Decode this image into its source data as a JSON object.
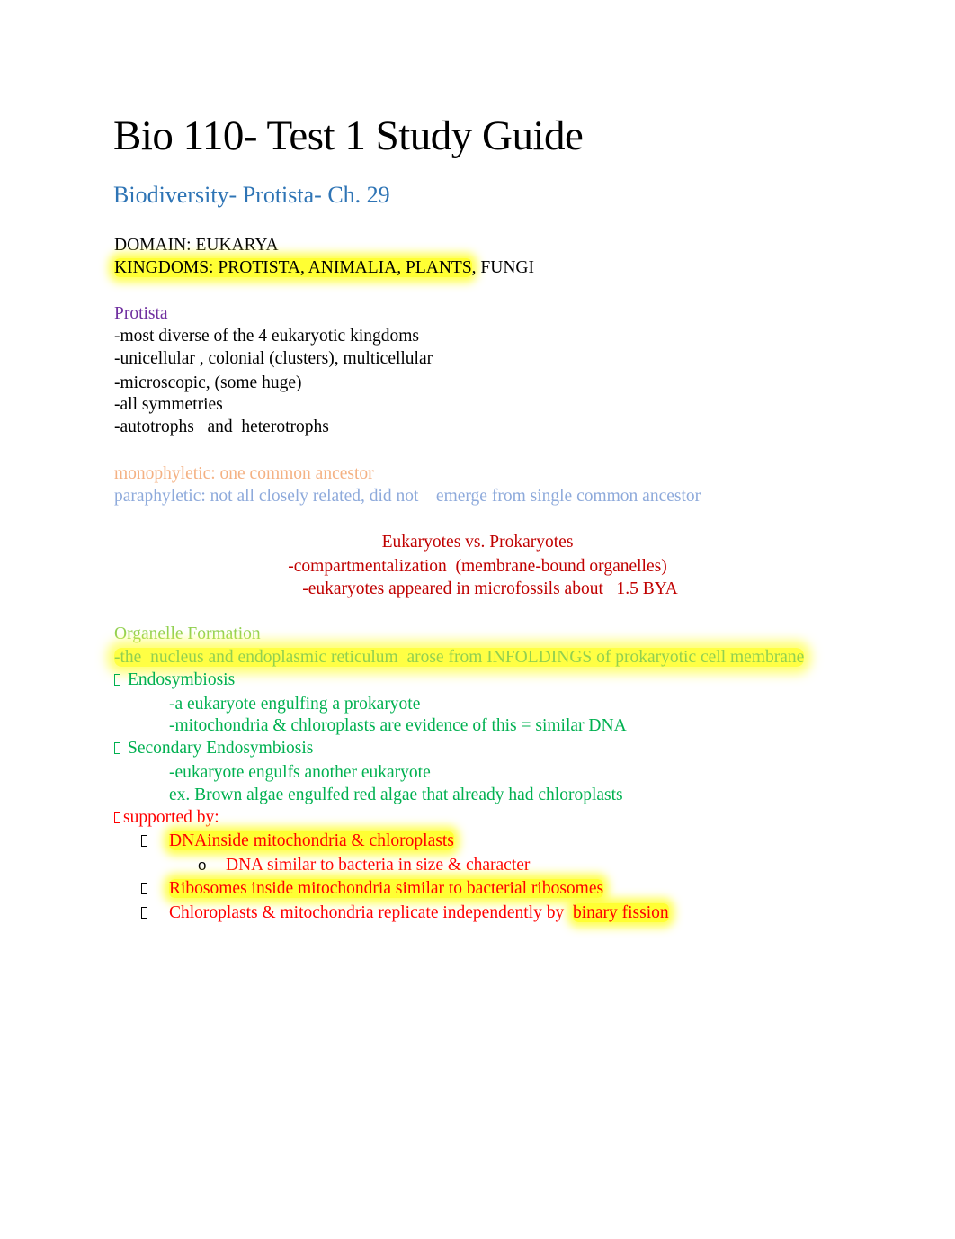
{
  "document": {
    "title": "Bio 110- Test 1 Study Guide",
    "subtitle": "Biodiversity- Protista- Ch. 29",
    "domain_line": "DOMAIN: EUKARYA",
    "kingdoms": {
      "highlighted": "KINGDOMS: PROTISTA, ANIMALIA, PLANTS",
      "rest": ", FUNGI"
    },
    "protista": {
      "heading": "Protista",
      "items": [
        "-most diverse of the 4 eukaryotic kingdoms",
        "-unicellular , colonial (clusters), multicellular",
        "-microscopic, (some huge)",
        "-all symmetries",
        "-autotrophs   and  heterotrophs"
      ]
    },
    "definitions": {
      "monophyletic": "monophyletic: one common ancestor",
      "paraphyletic": "paraphyletic: not all closely related, did not    emerge from single common ancestor"
    },
    "euk_vs_prok": {
      "heading": "Eukaryotes vs. Prokaryotes",
      "items": [
        "-compartmentalization  (membrane-bound organelles)",
        "-eukaryotes appeared in microfossils about   1.5 BYA"
      ]
    },
    "organelle_formation": {
      "heading": "Organelle Formation",
      "infolding": "-the  nucleus and endoplasmic reticulum  arose from INFOLDINGS of prokaryotic cell membrane",
      "endosymbiosis": {
        "label": "Endosymbiosis",
        "items": [
          "-a eukaryote engulfing a prokaryote",
          "-mitochondria & chloroplasts are evidence of this = similar DNA"
        ]
      },
      "secondary_endosymbiosis": {
        "label": "Secondary Endosymbiosis",
        "items": [
          "-eukaryote engulfs another eukaryote",
          "ex. Brown algae engulfed red algae that already had chloroplasts"
        ]
      },
      "supported_by": {
        "label": "supported by:",
        "items": [
          {
            "text": "DNAinside mitochondria & chloroplasts",
            "sub": [
              "DNA similar to bacteria in size & character"
            ]
          },
          {
            "text": "Ribosomes inside mitochondria similar to bacterial ribosomes"
          },
          {
            "text_plain": "Chloroplasts & mitochondria replicate independently by  ",
            "text_highlighted": "binary fission"
          }
        ],
        "sub_bullet": "o"
      }
    }
  }
}
